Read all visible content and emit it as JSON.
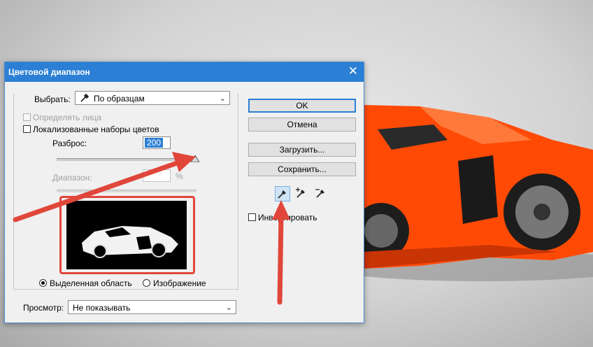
{
  "dialog": {
    "title": "Цветовой диапазон",
    "select_label": "Выбрать:",
    "select_value": "По образцам",
    "detect_faces_label": "Определять лица",
    "localized_label": "Локализованные наборы цветов",
    "fuzziness_label": "Разброс:",
    "fuzziness_value": "200",
    "range_label": "Диапазон:",
    "percent_sign": "%",
    "selection_label": "Выделенная область",
    "image_label": "Изображение",
    "preview_label": "Просмотр:",
    "preview_value": "Не показывать",
    "ok_label": "OK",
    "cancel_label": "Отмена",
    "load_label": "Загрузить...",
    "save_label": "Сохранить...",
    "invert_label": "Инвертировать"
  },
  "colors": {
    "titlebar": "#2b7fd4",
    "highlight_frame": "#e0463a",
    "annotation_arrow": "#e0463a",
    "car_body": "#ff4a05"
  },
  "state": {
    "fuzziness_slider_fraction": 1.0,
    "selection_radio": "selection",
    "invert_checked": false,
    "active_eyedropper": "sample"
  }
}
